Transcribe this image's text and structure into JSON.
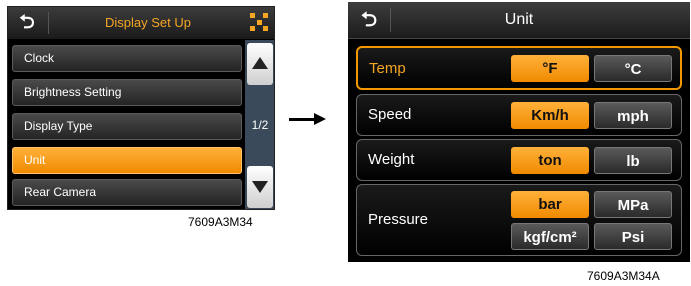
{
  "left_screen": {
    "back_label": "⮌",
    "title": "Display Set Up",
    "menu_items": [
      {
        "label": "Clock",
        "selected": false
      },
      {
        "label": "Brightness Setting",
        "selected": false
      },
      {
        "label": "Display Type",
        "selected": false
      },
      {
        "label": "Unit",
        "selected": true
      },
      {
        "label": "Rear Camera",
        "selected": false
      }
    ],
    "page_indicator": "1/2",
    "caption": "7609A3M34"
  },
  "right_screen": {
    "back_label": "⮌",
    "title": "Unit",
    "rows": [
      {
        "label": "Temp",
        "active": true,
        "options": [
          "°F",
          "°C"
        ],
        "selected": "°F"
      },
      {
        "label": "Speed",
        "active": false,
        "options": [
          "Km/h",
          "mph"
        ],
        "selected": "Km/h"
      },
      {
        "label": "Weight",
        "active": false,
        "options": [
          "ton",
          "lb"
        ],
        "selected": "ton"
      },
      {
        "label": "Pressure",
        "active": false,
        "options": [
          "bar",
          "MPa",
          "kgf/cm²",
          "Psi"
        ],
        "selected": "bar"
      }
    ],
    "caption": "7609A3M34A"
  },
  "colors": {
    "accent_orange": "#f39800",
    "title_orange": "#f5a623",
    "scroll_column": "#3a4a5a"
  }
}
